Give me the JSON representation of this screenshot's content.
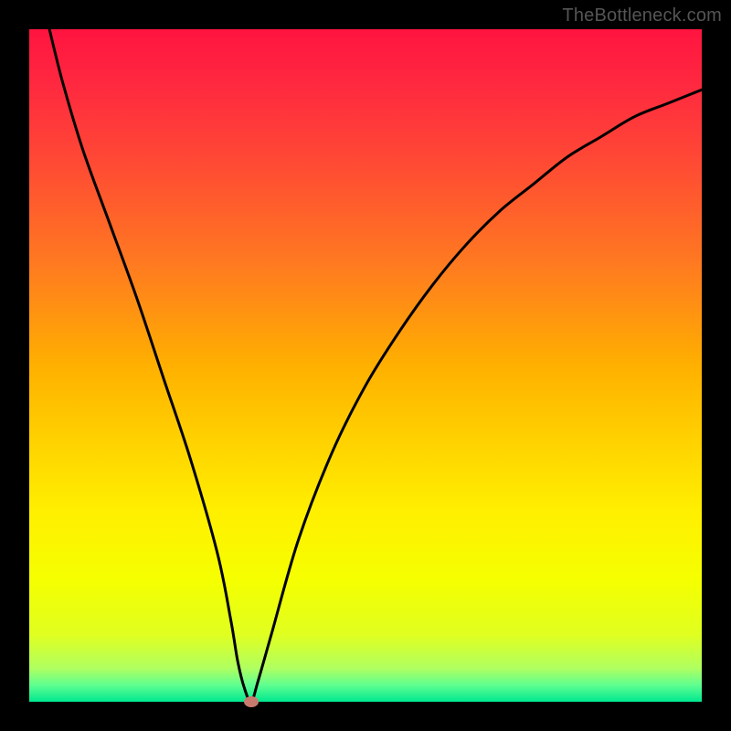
{
  "watermark": {
    "text": "TheBottleneck.com"
  },
  "colors": {
    "gradient_stops": [
      {
        "offset": 0.0,
        "color": "#ff1440"
      },
      {
        "offset": 0.08,
        "color": "#ff2840"
      },
      {
        "offset": 0.2,
        "color": "#ff4a34"
      },
      {
        "offset": 0.35,
        "color": "#ff7a20"
      },
      {
        "offset": 0.5,
        "color": "#ffb000"
      },
      {
        "offset": 0.62,
        "color": "#ffd400"
      },
      {
        "offset": 0.72,
        "color": "#fff000"
      },
      {
        "offset": 0.82,
        "color": "#f5ff00"
      },
      {
        "offset": 0.9,
        "color": "#e0ff20"
      },
      {
        "offset": 0.95,
        "color": "#b0ff60"
      },
      {
        "offset": 0.975,
        "color": "#60ff90"
      },
      {
        "offset": 1.0,
        "color": "#00e890"
      }
    ],
    "curve_stroke": "#000000",
    "marker_fill": "#c97a6e"
  },
  "chart_data": {
    "type": "line",
    "title": "",
    "xlabel": "",
    "ylabel": "",
    "xlim": [
      0,
      100
    ],
    "ylim": [
      0,
      100
    ],
    "grid": false,
    "legend": false,
    "series": [
      {
        "name": "bottleneck-curve",
        "x": [
          3,
          5,
          8,
          12,
          16,
          20,
          24,
          28,
          30,
          31,
          32,
          33,
          34,
          36,
          40,
          45,
          50,
          55,
          60,
          65,
          70,
          75,
          80,
          85,
          90,
          95,
          100
        ],
        "values": [
          100,
          92,
          82,
          71,
          60,
          48,
          36,
          22,
          12,
          6,
          2,
          0,
          3,
          10,
          24,
          37,
          47,
          55,
          62,
          68,
          73,
          77,
          81,
          84,
          87,
          89,
          91
        ]
      }
    ],
    "annotations": [
      {
        "name": "minimum-marker",
        "x": 33,
        "y": 0
      }
    ]
  }
}
